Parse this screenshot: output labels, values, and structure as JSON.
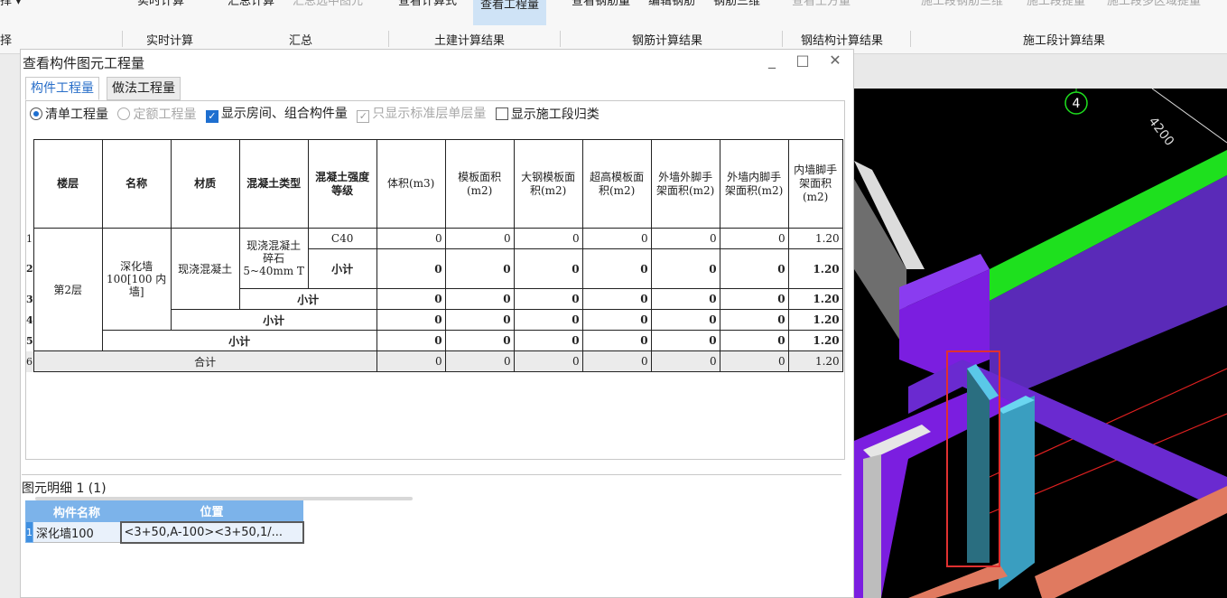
{
  "ribbon": {
    "left_top": "择",
    "left_bottom": "择",
    "buttons": [
      {
        "label": "实时计算",
        "dim": false
      },
      {
        "label": "汇总计算",
        "dim": false
      },
      {
        "label": "汇总选中图元",
        "dim": true
      },
      {
        "label": "查看计算式",
        "dim": false
      },
      {
        "label": "查看工程量",
        "dim": false,
        "active": true
      },
      {
        "label": "查看钢筋量",
        "dim": false
      },
      {
        "label": "编辑钢筋",
        "dim": false
      },
      {
        "label": "钢筋三维",
        "dim": false
      },
      {
        "label": "查看土方量",
        "dim": true
      },
      {
        "label": "施工段钢筋三维",
        "dim": true
      },
      {
        "label": "施工段提量",
        "dim": true
      },
      {
        "label": "施工段多区域提量",
        "dim": true
      }
    ],
    "groups": [
      "选择",
      "实时计算",
      "汇总",
      "土建计算结果",
      "钢筋计算结果",
      "钢结构计算结果",
      "施工段计算结果"
    ]
  },
  "dialog": {
    "title": "查看构件图元工程量",
    "controls": [
      "_",
      "□",
      "✕"
    ],
    "tabs": [
      "构件工程量",
      "做法工程量"
    ],
    "options": [
      {
        "label": "清单工程量",
        "type": "radio",
        "checked": true,
        "dim": false
      },
      {
        "label": "定额工程量",
        "type": "radio",
        "checked": false,
        "dim": true
      },
      {
        "label": "显示房间、组合构件量",
        "type": "checkbox",
        "checked": true,
        "dim": false
      },
      {
        "label": "只显示标准层单层量",
        "type": "checkbox",
        "checked": true,
        "dim": true
      },
      {
        "label": "显示施工段归类",
        "type": "checkbox",
        "checked": false,
        "dim": false
      }
    ]
  },
  "table": {
    "headers": [
      "楼层",
      "名称",
      "材质",
      "混凝土类型",
      "混凝土强度等级",
      "体积(m3)",
      "模板面积(m2)",
      "大钢模板面积(m2)",
      "超高模板面积(m2)",
      "外墙外脚手架面积(m2)",
      "外墙内脚手架面积(m2)",
      "内墙脚手架面积(m2)"
    ],
    "row_numbers": [
      "1",
      "2",
      "3",
      "4",
      "5",
      "6"
    ],
    "floor": "第2层",
    "name": "深化墙100[100 内墙]",
    "material": "现浇混凝土",
    "concrete_type": "现浇混凝土 碎石5~40mm T",
    "grade": "C40",
    "subtotal": "小计",
    "total": "合计",
    "values_row1": [
      "0",
      "0",
      "0",
      "0",
      "0",
      "0",
      "1.20"
    ],
    "values_subtotal": [
      "0",
      "0",
      "0",
      "0",
      "0",
      "0",
      "1.20"
    ],
    "values_total": [
      "0",
      "0",
      "0",
      "0",
      "0",
      "0",
      "1.20"
    ]
  },
  "detail": {
    "title": "图元明细",
    "count": "1 (1)",
    "headers": [
      "构件名称",
      "位置"
    ],
    "rows": [
      {
        "num": "1",
        "name": "深化墙100",
        "position": "<3+50,A-100><3+50,1/..."
      }
    ]
  },
  "viewport": {
    "axis_label": "4",
    "dimension": "4200",
    "colors": {
      "background": "#000000",
      "beam": "#7b1ee0",
      "wall_green": "#1ee01e",
      "highlight": "#e03030",
      "selected_wall": "#3fa8c8",
      "slab": "#e07a60"
    }
  }
}
